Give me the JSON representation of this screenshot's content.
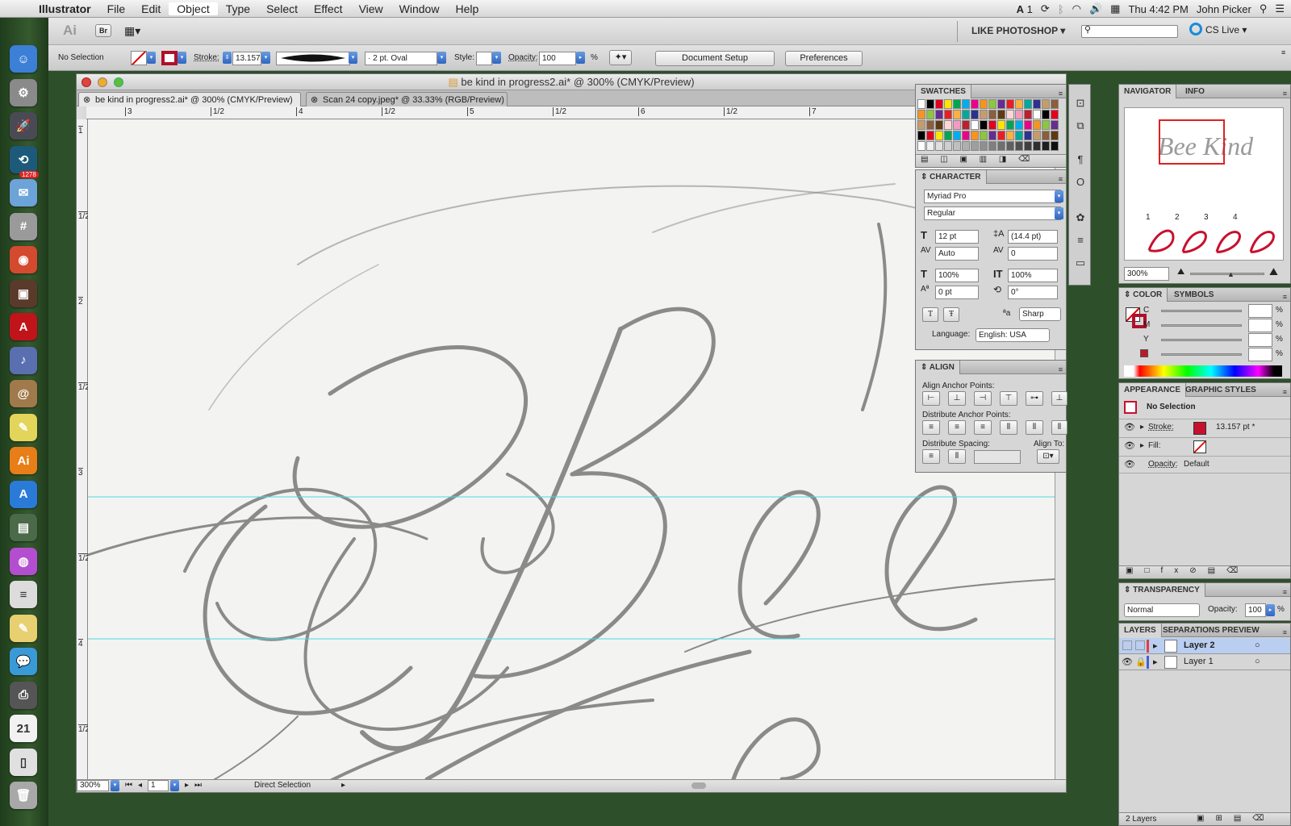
{
  "menubar": {
    "app": "Illustrator",
    "items": [
      "File",
      "Edit",
      "Object",
      "Type",
      "Select",
      "Effect",
      "View",
      "Window",
      "Help"
    ],
    "status": {
      "input": "A",
      "badge": "1",
      "clock": "Thu 4:42 PM",
      "user": "John Picker"
    }
  },
  "dock": {
    "items": [
      {
        "name": "finder-icon",
        "glyph": "☺",
        "color": "#3c7fd6"
      },
      {
        "name": "system-preferences-icon",
        "glyph": "⚙",
        "color": "#8a8a8a"
      },
      {
        "name": "launchpad-icon",
        "glyph": "🚀",
        "color": "#4a4a55"
      },
      {
        "name": "time-machine-icon",
        "glyph": "⟲",
        "color": "#1d5a7a"
      },
      {
        "name": "mail-icon",
        "glyph": "✉",
        "color": "#6ca3d8"
      },
      {
        "name": "calculator-icon",
        "glyph": "#",
        "color": "#9a9a9a"
      },
      {
        "name": "chrome-icon",
        "glyph": "◉",
        "color": "#d44a2e"
      },
      {
        "name": "photo-booth-icon",
        "glyph": "▣",
        "color": "#5a3a2a"
      },
      {
        "name": "acrobat-icon",
        "glyph": "A",
        "color": "#c0141a"
      },
      {
        "name": "itunes-icon",
        "glyph": "♪",
        "color": "#5a6fb0"
      },
      {
        "name": "address-book-icon",
        "glyph": "@",
        "color": "#a07a4a"
      },
      {
        "name": "stickies-icon",
        "glyph": "✎",
        "color": "#e3d45a"
      },
      {
        "name": "illustrator-icon",
        "glyph": "Ai",
        "color": "#e77e17"
      },
      {
        "name": "app-store-icon",
        "glyph": "A",
        "color": "#2a7ad8"
      },
      {
        "name": "hardware-monitor-icon",
        "glyph": "▤",
        "color": "#4a6a4a"
      },
      {
        "name": "itunes-purple-icon",
        "glyph": "◍",
        "color": "#b44ed0"
      },
      {
        "name": "textedit-icon",
        "glyph": "≡",
        "color": "#dcdcdc"
      },
      {
        "name": "notes-icon",
        "glyph": "✎",
        "color": "#e8d070"
      },
      {
        "name": "messages-icon",
        "glyph": "💬",
        "color": "#3a9ad8"
      },
      {
        "name": "printer-icon",
        "glyph": "⎙",
        "color": "#555"
      },
      {
        "name": "ical-icon",
        "glyph": "21",
        "color": "#f2f2f2"
      },
      {
        "name": "documents-icon",
        "glyph": "▯",
        "color": "#e0e0e0"
      },
      {
        "name": "trash-icon",
        "glyph": "🗑",
        "color": "#a8a8a8"
      }
    ],
    "mail_badge": "1278"
  },
  "appbar": {
    "logo": "Ai",
    "bridge": "Br",
    "workspace": "LIKE PHOTOSHOP",
    "search_placeholder": "",
    "cs_live": "CS Live"
  },
  "control": {
    "selection": "No Selection",
    "stroke_label": "Stroke:",
    "stroke_value": "13.157",
    "brush": "2 pt. Oval",
    "style_label": "Style:",
    "opacity_label": "Opacity:",
    "opacity_value": "100",
    "percent": "%",
    "document_setup": "Document Setup",
    "preferences": "Preferences"
  },
  "document": {
    "title": "be kind in progress2.ai* @ 300% (CMYK/Preview)",
    "tabs": [
      {
        "label": "be kind in progress2.ai* @ 300% (CMYK/Preview)",
        "active": true
      },
      {
        "label": "Scan 24 copy.jpeg* @ 33.33% (RGB/Preview)",
        "active": false
      }
    ],
    "hruler": [
      "3",
      "1/2",
      "4",
      "1/2",
      "5",
      "1/2",
      "6",
      "1/2",
      "7"
    ],
    "vruler": [
      "1",
      "1/2",
      "2",
      "1/2",
      "3",
      "1/2",
      "4",
      "1/2"
    ],
    "zoom": "300%",
    "page": "1",
    "status_tool": "Direct Selection"
  },
  "swatches": {
    "title": "SWATCHES"
  },
  "character": {
    "title": "CHARACTER",
    "font": "Myriad Pro",
    "style": "Regular",
    "size": "12 pt",
    "leading": "(14.4 pt)",
    "kerning": "Auto",
    "tracking": "0",
    "vscale": "100%",
    "hscale": "100%",
    "baseline": "0 pt",
    "rotation": "0°",
    "antialias": "Sharp",
    "language_label": "Language:",
    "language": "English: USA"
  },
  "align": {
    "title": "ALIGN",
    "anchor_label": "Align Anchor Points:",
    "distribute_label": "Distribute Anchor Points:",
    "spacing_label": "Distribute Spacing:",
    "align_to_label": "Align To:"
  },
  "navigator": {
    "tabs": [
      "NAVIGATOR",
      "INFO"
    ],
    "zoom": "300%",
    "thumb_text": "Bee Kind",
    "variants": [
      "1",
      "2",
      "3",
      "4"
    ]
  },
  "color": {
    "tabs": [
      "COLOR",
      "SYMBOLS"
    ],
    "channels": [
      "C",
      "M",
      "Y",
      "K"
    ],
    "k_swatch": "#c0182a"
  },
  "appearance": {
    "tabs": [
      "APPEARANCE",
      "GRAPHIC STYLES"
    ],
    "selection": "No Selection",
    "stroke_label": "Stroke:",
    "stroke_value": "13.157 pt *",
    "fill_label": "Fill:",
    "opacity_label": "Opacity:",
    "opacity_value": "Default"
  },
  "transparency": {
    "title": "TRANSPARENCY",
    "mode": "Normal",
    "opacity_label": "Opacity:",
    "opacity_value": "100",
    "percent": "%"
  },
  "layers": {
    "tabs": [
      "LAYERS",
      "SEPARATIONS PREVIEW"
    ],
    "items": [
      {
        "name": "Layer 2",
        "color": "#e04040",
        "selected": true
      },
      {
        "name": "Layer 1",
        "color": "#4060e0",
        "selected": false
      }
    ],
    "count": "2 Layers"
  },
  "colors": {
    "guide": "#4fd8e0",
    "accent_red": "#c8102e",
    "pencil": "#6a6a6a",
    "swatch_colors": [
      "#ffffff",
      "#000000",
      "#e3001b",
      "#ffe600",
      "#00a651",
      "#00aeef",
      "#ec008c",
      "#f7941d",
      "#8dc63f",
      "#662d91",
      "#ed1c24",
      "#fbb040",
      "#00a99d",
      "#2e3192",
      "#c69c6d",
      "#8b5e3c",
      "#603913",
      "#ffd5d5",
      "#f49ac1",
      "#be1e2d"
    ]
  }
}
